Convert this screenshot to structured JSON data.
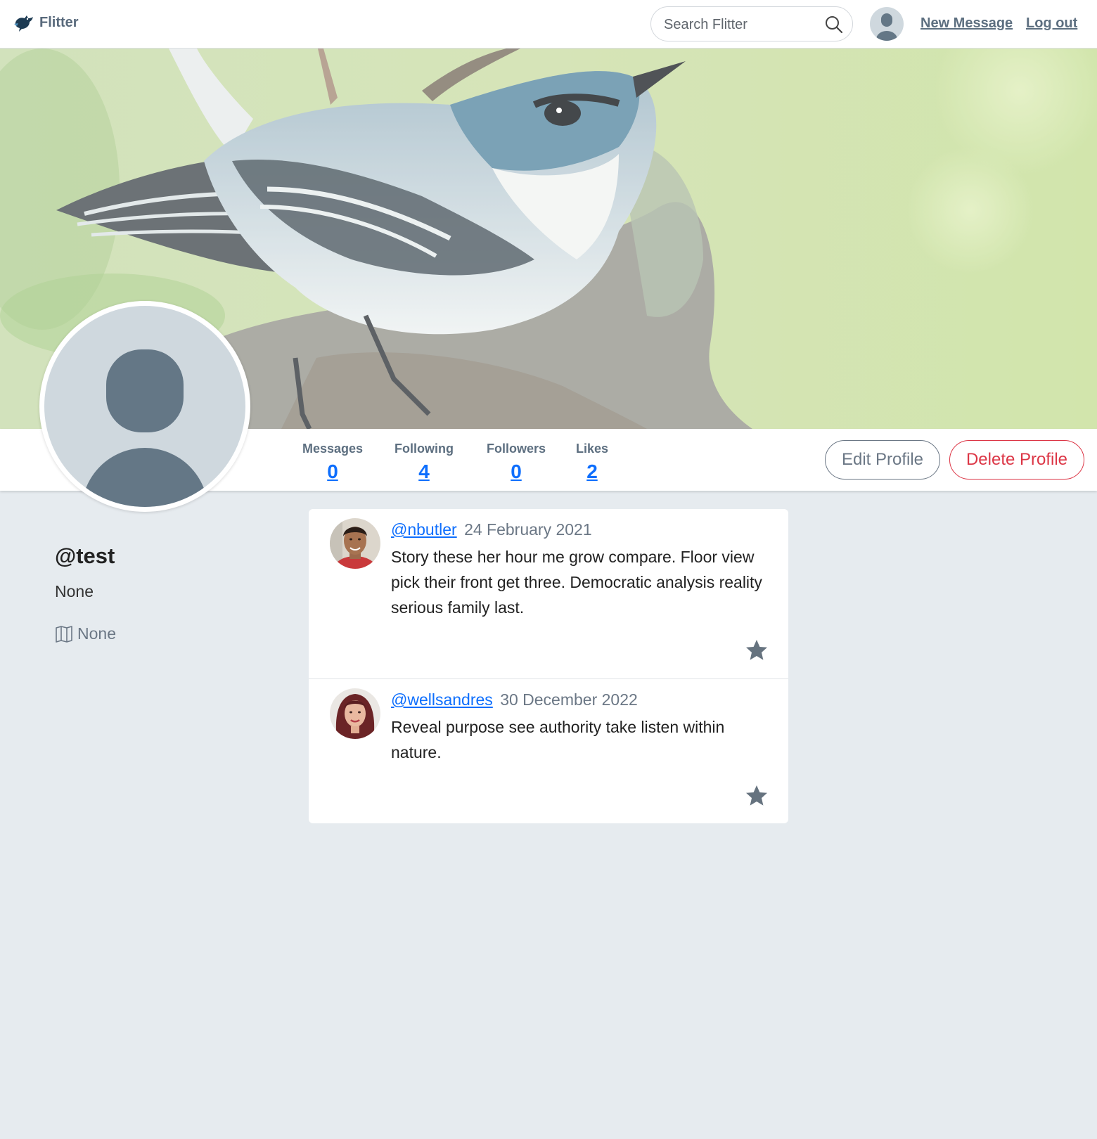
{
  "nav": {
    "brand": "Flitter",
    "search_placeholder": "Search Flitter",
    "new_message": "New Message",
    "logout": "Log out"
  },
  "profile": {
    "username": "@test",
    "bio": "None",
    "location": "None"
  },
  "stats": [
    {
      "label": "Messages",
      "value": "0"
    },
    {
      "label": "Following",
      "value": "4"
    },
    {
      "label": "Followers",
      "value": "0"
    },
    {
      "label": "Likes",
      "value": "2"
    }
  ],
  "actions": {
    "edit": "Edit Profile",
    "delete": "Delete Profile"
  },
  "posts": [
    {
      "user": "@nbutler",
      "date": "24 February 2021",
      "text": "Story these her hour me grow compare. Floor view pick their front get three. Democratic analysis reality serious family last."
    },
    {
      "user": "@wellsandres",
      "date": "30 December 2022",
      "text": "Reveal purpose see authority take listen within nature."
    }
  ],
  "colors": {
    "link": "#0d6efd",
    "danger": "#dc3545",
    "muted": "#6b7785",
    "page_bg": "#e6ebef"
  }
}
